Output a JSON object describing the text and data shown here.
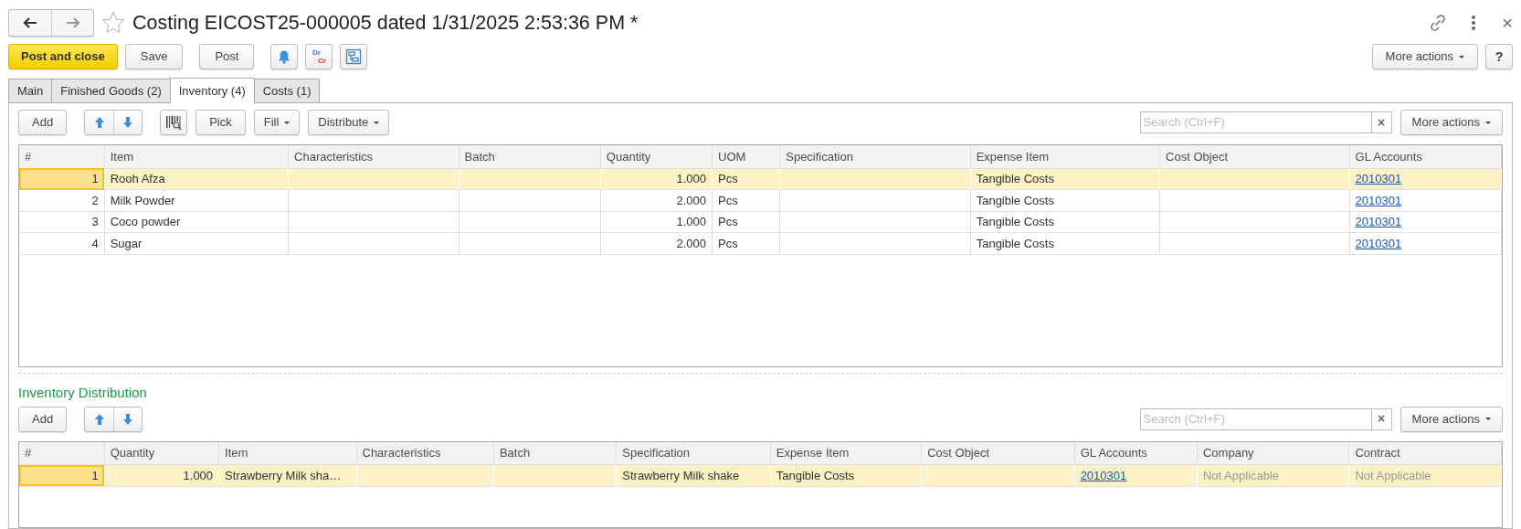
{
  "window": {
    "title": "Costing EICOST25-000005 dated 1/31/2025 2:53:36 PM *",
    "favorite": false,
    "close": "×"
  },
  "toolbar": {
    "buttons": [
      {
        "kind": "primary",
        "label": "Post and close"
      },
      {
        "kind": "plain",
        "label": "Save"
      },
      {
        "kind": "plain",
        "label": "Post"
      },
      {
        "kind": "bell"
      },
      {
        "kind": "drcr",
        "top": "Dr",
        "bottom": "Cr"
      },
      {
        "kind": "structure"
      }
    ],
    "more": "More actions",
    "help": "?"
  },
  "tabs": [
    {
      "label": "Main",
      "selected": false
    },
    {
      "label": "Finished Goods (2)",
      "selected": false
    },
    {
      "label": "Inventory (4)",
      "selected": true
    },
    {
      "label": "Costs (1)",
      "selected": false
    }
  ],
  "inventory": {
    "toolbar": {
      "buttons": [
        {
          "kind": "plain",
          "label": "Add"
        },
        {
          "kind": "updown"
        },
        {
          "kind": "barcode"
        },
        {
          "kind": "plain",
          "label": "Pick"
        },
        {
          "kind": "menu",
          "label": "Fill"
        },
        {
          "kind": "menu",
          "label": "Distribute"
        }
      ],
      "search": {
        "placeholder": "Search (Ctrl+F)",
        "clear": "×"
      },
      "more": "More actions"
    },
    "table": {
      "columns": [
        {
          "label": "#",
          "kind": "number"
        },
        {
          "label": "Item",
          "kind": "text"
        },
        {
          "label": "Characteristics",
          "kind": "text"
        },
        {
          "label": "Batch",
          "kind": "text"
        },
        {
          "label": "Quantity",
          "kind": "number"
        },
        {
          "label": "UOM",
          "kind": "text"
        },
        {
          "label": "Specification",
          "kind": "text"
        },
        {
          "label": "Expense Item",
          "kind": "text"
        },
        {
          "label": "Cost Object",
          "kind": "text"
        },
        {
          "label": "GL Accounts",
          "kind": "link"
        }
      ],
      "rows": [
        {
          "selected": true,
          "cells": [
            "1",
            "Rooh Afza",
            "",
            "",
            "1.000",
            "Pcs",
            "",
            "Tangible Costs",
            "",
            "2010301"
          ]
        },
        {
          "selected": false,
          "cells": [
            "2",
            "Milk Powder",
            "",
            "",
            "2.000",
            "Pcs",
            "",
            "Tangible Costs",
            "",
            "2010301"
          ]
        },
        {
          "selected": false,
          "cells": [
            "3",
            "Coco powder",
            "",
            "",
            "1.000",
            "Pcs",
            "",
            "Tangible Costs",
            "",
            "2010301"
          ]
        },
        {
          "selected": false,
          "cells": [
            "4",
            "Sugar",
            "",
            "",
            "2.000",
            "Pcs",
            "",
            "Tangible Costs",
            "",
            "2010301"
          ]
        }
      ]
    }
  },
  "distribution": {
    "title": "Inventory Distribution",
    "toolbar": {
      "buttons": [
        {
          "kind": "plain",
          "label": "Add"
        },
        {
          "kind": "updown"
        }
      ],
      "search": {
        "placeholder": "Search (Ctrl+F)",
        "clear": "×"
      },
      "more": "More actions"
    },
    "table": {
      "columns": [
        {
          "label": "#",
          "kind": "number"
        },
        {
          "label": "Quantity",
          "kind": "number"
        },
        {
          "label": "Item",
          "kind": "text"
        },
        {
          "label": "Characteristics",
          "kind": "text"
        },
        {
          "label": "Batch",
          "kind": "text"
        },
        {
          "label": "Specification",
          "kind": "text"
        },
        {
          "label": "Expense Item",
          "kind": "text"
        },
        {
          "label": "Cost Object",
          "kind": "text"
        },
        {
          "label": "GL Accounts",
          "kind": "link"
        },
        {
          "label": "Company",
          "kind": "muted"
        },
        {
          "label": "Contract",
          "kind": "muted"
        }
      ],
      "rows": [
        {
          "selected": true,
          "cells": [
            "1",
            "1.000",
            "Strawberry Milk sha…",
            "",
            "",
            "Strawberry Milk shake",
            "Tangible Costs",
            "",
            "2010301",
            "Not Applicable",
            "Not Applicable"
          ]
        }
      ]
    }
  }
}
